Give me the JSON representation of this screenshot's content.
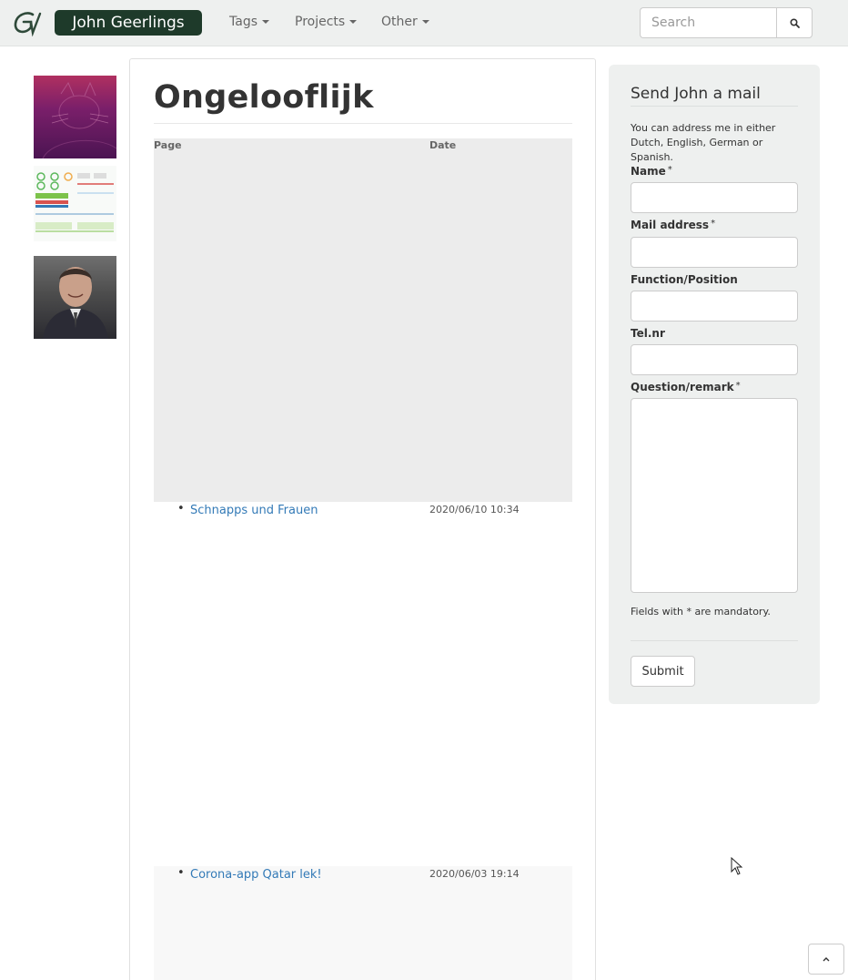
{
  "navbar": {
    "brand": "John Geerlings",
    "menus": [
      {
        "label": "Tags"
      },
      {
        "label": "Projects"
      },
      {
        "label": "Other"
      }
    ],
    "search": {
      "placeholder": "Search",
      "value": ""
    }
  },
  "main": {
    "title": "Ongelooflijk",
    "table": {
      "columns": [
        "Page",
        "Date"
      ],
      "rows": [
        {
          "page": "Schnapps und Frauen",
          "date": "2020/06/10 10:34"
        },
        {
          "page": "Corona-app Qatar lek!",
          "date": "2020/06/03 19:14"
        }
      ]
    }
  },
  "sidebar": {
    "title": "Send John a mail",
    "intro": "You can address me in either Dutch, English, German or Spanish.",
    "fields": {
      "name": {
        "label": "Name",
        "required_mark": "*"
      },
      "mail": {
        "label": "Mail address",
        "required_mark": "*"
      },
      "function": {
        "label": "Function/Position"
      },
      "tel": {
        "label": "Tel.nr"
      },
      "question": {
        "label": "Question/remark",
        "required_mark": "*"
      }
    },
    "note": "Fields with * are mandatory.",
    "submit_label": "Submit"
  },
  "colors": {
    "brand_bg": "#1e3a2a",
    "navbar_bg": "#eef0ef",
    "link": "#337ab7"
  }
}
